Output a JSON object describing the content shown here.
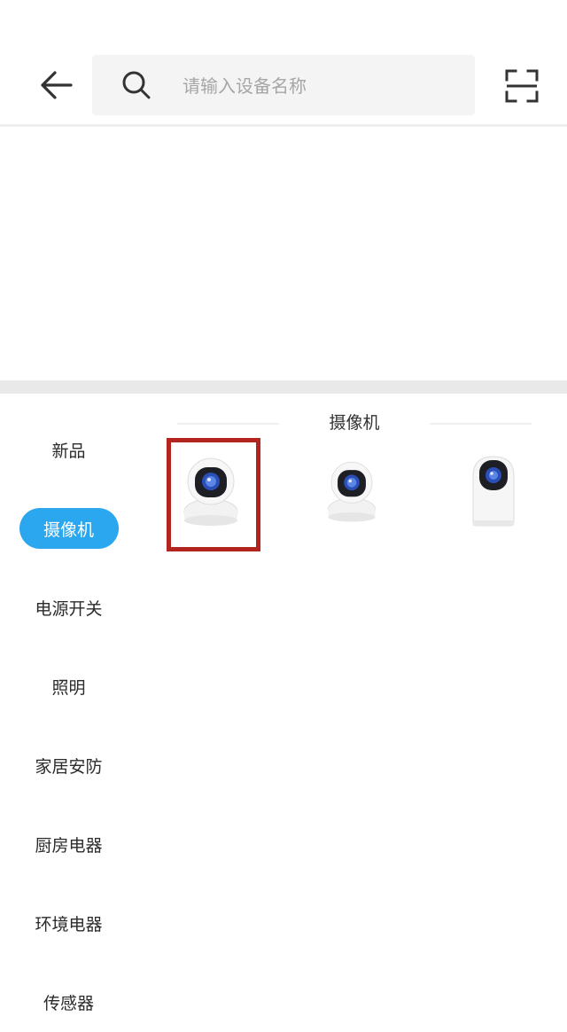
{
  "header": {
    "search_placeholder": "请输入设备名称",
    "icons": [
      "back-arrow-icon",
      "search-icon",
      "scan-icon"
    ]
  },
  "sidebar": {
    "active_color": "#2aa7ee",
    "items": [
      {
        "label": "新品"
      },
      {
        "label": "摄像机",
        "active": true
      },
      {
        "label": "电源开关"
      },
      {
        "label": "照明"
      },
      {
        "label": "家居安防"
      },
      {
        "label": "厨房电器"
      },
      {
        "label": "环境电器"
      },
      {
        "label": "传感器"
      }
    ]
  },
  "content": {
    "section_title": "摄像机",
    "products": [
      {
        "icon": "pan-tilt-camera-icon",
        "highlighted": true
      },
      {
        "icon": "pan-tilt-camera-icon"
      },
      {
        "icon": "cube-camera-icon"
      }
    ],
    "highlight_color": "#b3241f"
  }
}
